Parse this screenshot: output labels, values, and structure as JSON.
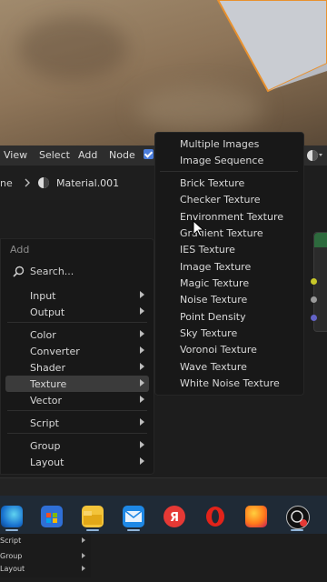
{
  "header_menu": [
    "View",
    "Select",
    "Add",
    "Node"
  ],
  "breadcrumb": {
    "partial": "ne",
    "material": "Material.001"
  },
  "add_menu": {
    "title": "Add",
    "search_placeholder": "Search...",
    "groups": [
      [
        "Input",
        "Output"
      ],
      [
        "Color",
        "Converter",
        "Shader",
        "Texture",
        "Vector"
      ],
      [
        "Script"
      ],
      [
        "Group",
        "Layout"
      ]
    ],
    "active_item": "Texture"
  },
  "texture_submenu": {
    "top_items": [
      "Multiple Images",
      "Image Sequence"
    ],
    "items": [
      "Brick Texture",
      "Checker Texture",
      "Environment Texture",
      "Gradient Texture",
      "IES Texture",
      "Image Texture",
      "Magic Texture",
      "Noise Texture",
      "Point Density",
      "Sky Texture",
      "Voronoi Texture",
      "Wave Texture",
      "White Noise Texture"
    ]
  },
  "taskbar_icons": [
    "edge-icon",
    "store-icon",
    "folder-icon",
    "mail-icon",
    "yandex-icon",
    "opera-icon",
    "firefox-icon",
    "obs-icon"
  ],
  "bottom_panel": [
    "Script",
    "Group",
    "Layout"
  ],
  "colors": {
    "accent": "#4b7ddb",
    "highlight": "#3b3b3b",
    "taskbar": "#1f2a36",
    "node_header": "#2d6a3d"
  }
}
